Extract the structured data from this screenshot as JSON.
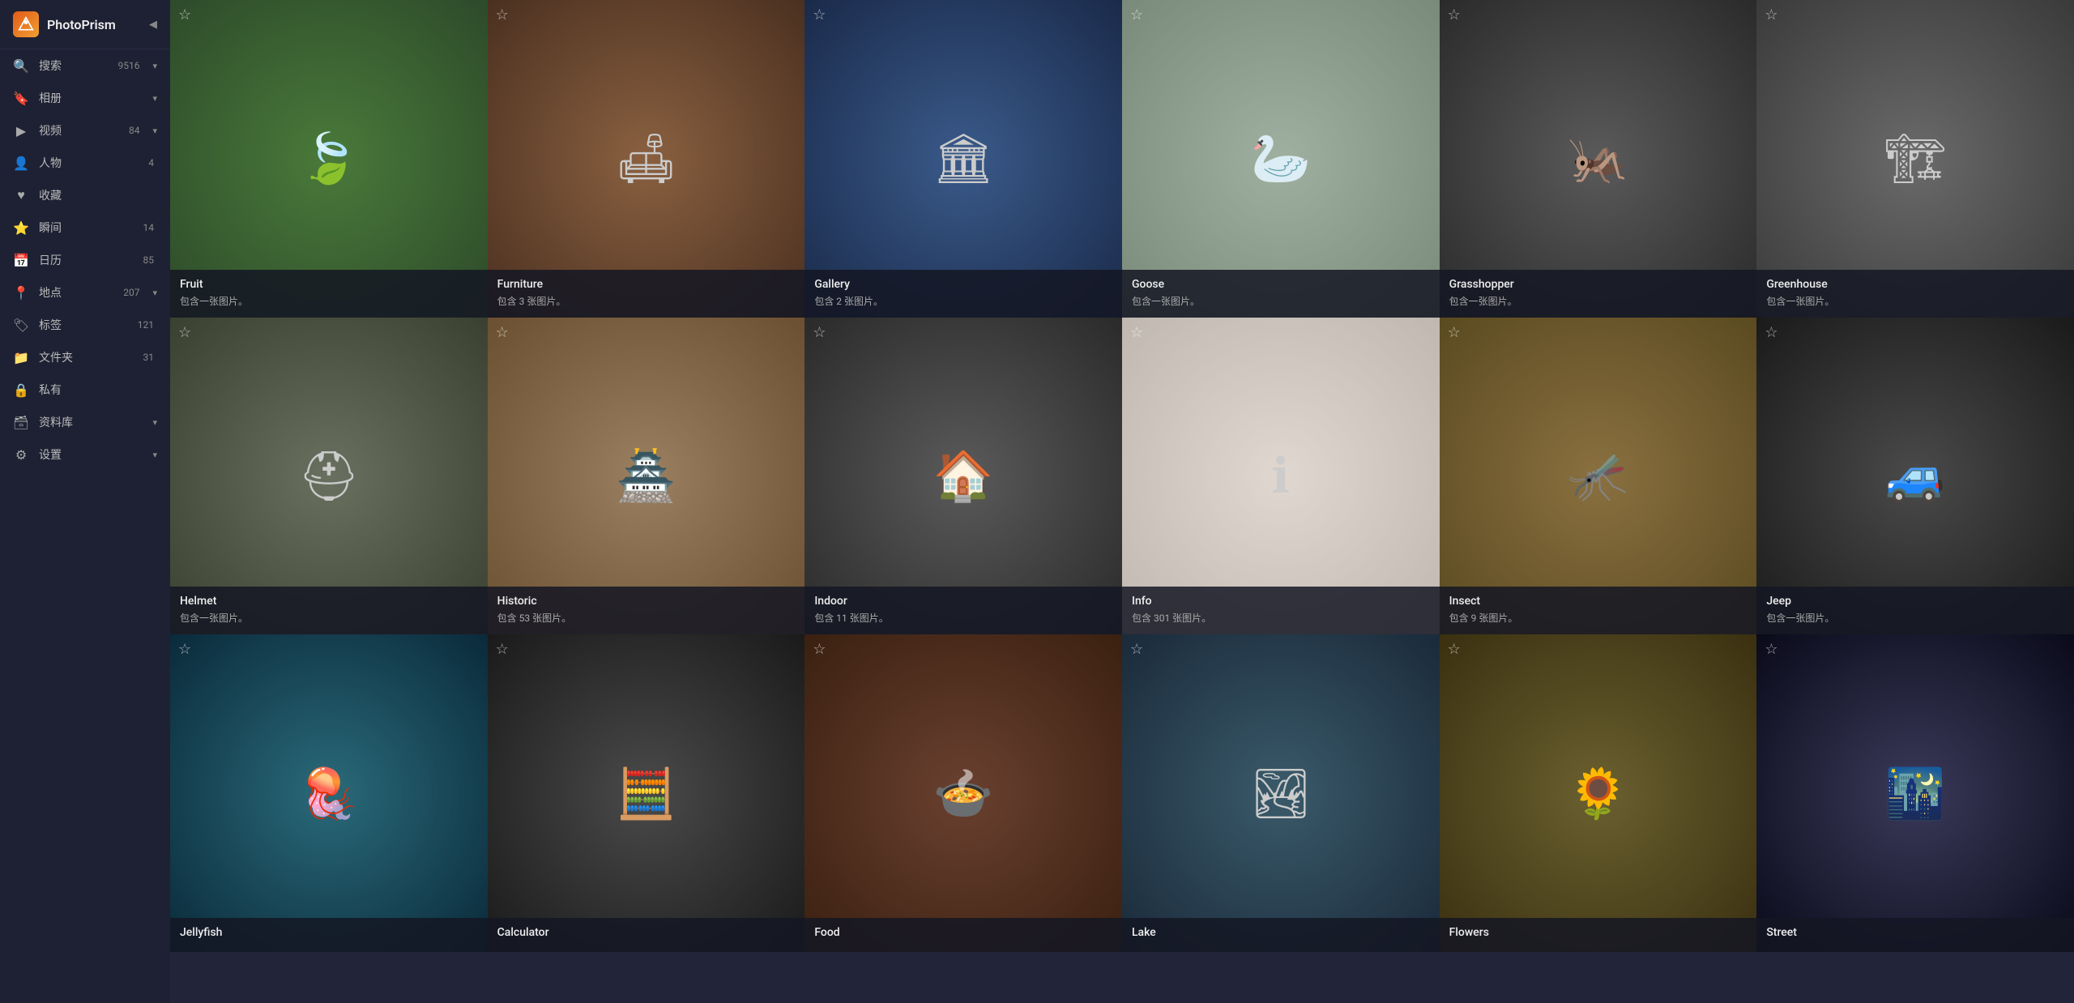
{
  "app": {
    "title": "PhotoPrism",
    "logo_alt": "PhotoPrism Logo"
  },
  "sidebar": {
    "collapse_label": "◀",
    "items": [
      {
        "id": "search",
        "icon": "🔍",
        "label": "搜索",
        "count": "9516",
        "expandable": true
      },
      {
        "id": "albums",
        "icon": "🔖",
        "label": "相册",
        "count": "",
        "expandable": true
      },
      {
        "id": "videos",
        "icon": "▶",
        "label": "视频",
        "count": "84",
        "expandable": true
      },
      {
        "id": "people",
        "icon": "👤",
        "label": "人物",
        "count": "4",
        "expandable": false
      },
      {
        "id": "favorites",
        "icon": "♥",
        "label": "收藏",
        "count": "",
        "expandable": false
      },
      {
        "id": "moments",
        "icon": "⭐",
        "label": "瞬间",
        "count": "14",
        "expandable": false
      },
      {
        "id": "calendar",
        "icon": "📅",
        "label": "日历",
        "count": "85",
        "expandable": false
      },
      {
        "id": "places",
        "icon": "📍",
        "label": "地点",
        "count": "207",
        "expandable": true
      },
      {
        "id": "labels",
        "icon": "🏷",
        "label": "标签",
        "count": "121",
        "expandable": false
      },
      {
        "id": "folders",
        "icon": "📁",
        "label": "文件夹",
        "count": "31",
        "expandable": false
      },
      {
        "id": "private",
        "icon": "🔒",
        "label": "私有",
        "count": "",
        "expandable": false
      },
      {
        "id": "library",
        "icon": "🗃",
        "label": "资料库",
        "count": "",
        "expandable": true
      },
      {
        "id": "settings",
        "icon": "⚙",
        "label": "设置",
        "count": "",
        "expandable": true
      }
    ]
  },
  "grid": {
    "rows": [
      [
        {
          "title": "Fruit",
          "subtitle": "包含一张图片。",
          "bg": "bg-green",
          "emoji": "🍃",
          "has_star": true
        },
        {
          "title": "Furniture",
          "subtitle": "包含 3 张图片。",
          "bg": "bg-brown",
          "emoji": "🛋",
          "has_star": true
        },
        {
          "title": "Gallery",
          "subtitle": "包含 2 张图片。",
          "bg": "bg-sky",
          "emoji": "🏛",
          "has_star": true
        },
        {
          "title": "Goose",
          "subtitle": "包含一张图片。",
          "bg": "bg-white",
          "emoji": "🦢",
          "has_star": true
        },
        {
          "title": "Grasshopper",
          "subtitle": "包含一张图片。",
          "bg": "bg-dark",
          "emoji": "🦗",
          "has_star": true
        },
        {
          "title": "Greenhouse",
          "subtitle": "包含一张图片。",
          "bg": "bg-gray",
          "emoji": "🏗",
          "has_star": true
        }
      ],
      [
        {
          "title": "Helmet",
          "subtitle": "包含一张图片。",
          "bg": "bg-olive",
          "emoji": "⛑",
          "has_star": true
        },
        {
          "title": "Historic",
          "subtitle": "包含 53 张图片。",
          "bg": "bg-tan",
          "emoji": "🏯",
          "has_star": true
        },
        {
          "title": "Indoor",
          "subtitle": "包含 11 张图片。",
          "bg": "bg-gray",
          "emoji": "🏠",
          "has_star": true
        },
        {
          "title": "Info",
          "subtitle": "包含 301 张图片。",
          "bg": "bg-marble",
          "emoji": "ℹ",
          "has_star": true
        },
        {
          "title": "Insect",
          "subtitle": "包含 9 张图片。",
          "bg": "bg-golden",
          "emoji": "🦟",
          "has_star": true
        },
        {
          "title": "Jeep",
          "subtitle": "包含一张图片。",
          "bg": "bg-dark",
          "emoji": "🚙",
          "has_star": true
        }
      ],
      [
        {
          "title": "Jellyfish",
          "subtitle": "",
          "bg": "bg-teal",
          "emoji": "🪼",
          "has_star": false
        },
        {
          "title": "Calculator",
          "subtitle": "",
          "bg": "bg-dark",
          "emoji": "🧮",
          "has_star": false
        },
        {
          "title": "Food",
          "subtitle": "",
          "bg": "bg-brown",
          "emoji": "🍲",
          "has_star": false
        },
        {
          "title": "Lake",
          "subtitle": "",
          "bg": "bg-sky",
          "emoji": "🏞",
          "has_star": false
        },
        {
          "title": "Flowers",
          "subtitle": "",
          "bg": "bg-golden",
          "emoji": "🌻",
          "has_star": false
        },
        {
          "title": "Street",
          "subtitle": "",
          "bg": "bg-night",
          "emoji": "🌃",
          "has_star": false
        }
      ]
    ]
  }
}
